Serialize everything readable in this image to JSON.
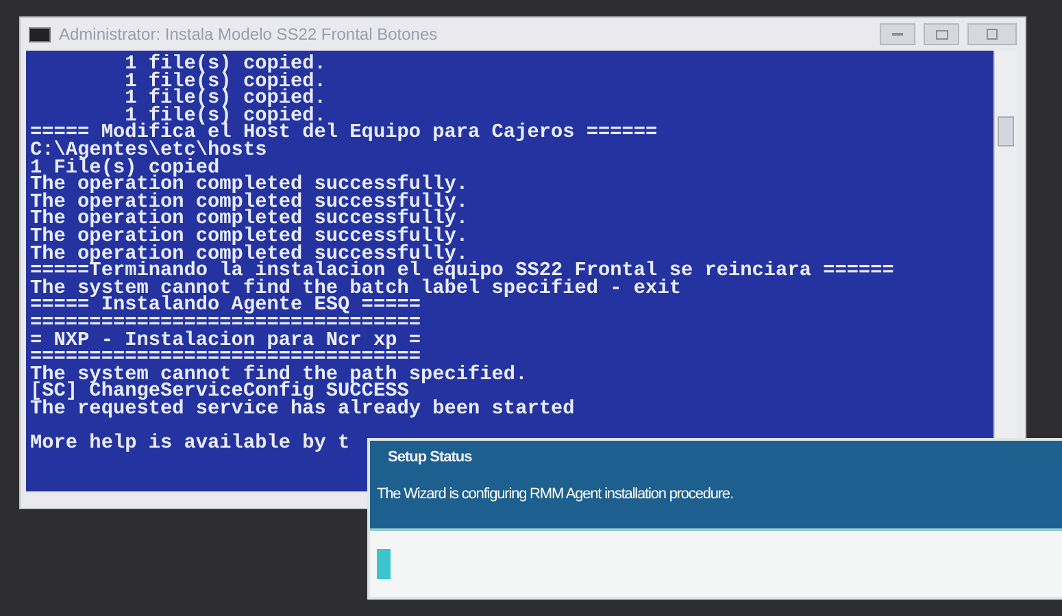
{
  "window": {
    "title": "Administrator: Instala Modelo SS22 Frontal Botones"
  },
  "console": {
    "lines": [
      "        1 file(s) copied.",
      "        1 file(s) copied.",
      "        1 file(s) copied.",
      "        1 file(s) copied.",
      "===== Modifica el Host del Equipo para Cajeros ======",
      "C:\\Agentes\\etc\\hosts",
      "1 File(s) copied",
      "The operation completed successfully.",
      "The operation completed successfully.",
      "The operation completed successfully.",
      "The operation completed successfully.",
      "The operation completed successfully.",
      "=====Terminando la instalacion el equipo SS22 Frontal se reinciara ======",
      "The system cannot find the batch label specified - exit",
      "===== Instalando Agente ESQ =====",
      "=================================",
      "= NXP - Instalacion para Ncr xp =",
      "=================================",
      "The system cannot find the path specified.",
      "[SC] ChangeServiceConfig SUCCESS",
      "The requested service has already been started"
    ],
    "help": "More help is available by t"
  },
  "dialog": {
    "title": "Setup Status",
    "message": "The Wizard is configuring RMM Agent installation procedure.",
    "progress": {
      "level": 0.02
    }
  }
}
